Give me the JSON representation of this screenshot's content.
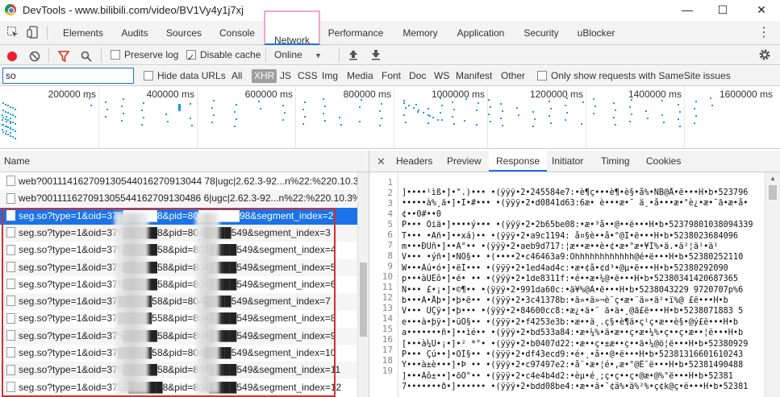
{
  "window": {
    "title": "DevTools - www.bilibili.com/video/BV1Vy4y1j7xj",
    "minimize": "—",
    "maximize": "☐",
    "close": "✕"
  },
  "main_tabs": [
    "Elements",
    "Audits",
    "Sources",
    "Console",
    "Network",
    "Performance",
    "Memory",
    "Application",
    "Security",
    "uBlocker"
  ],
  "active_main_tab": "Network",
  "network_toolbar": {
    "preserve_log": "Preserve log",
    "preserve_log_checked": false,
    "disable_cache": "Disable cache",
    "disable_cache_checked": true,
    "throttle": "Online"
  },
  "filter": {
    "value": "so",
    "hide_data_urls": "Hide data URLs",
    "types": [
      "All",
      "XHR",
      "JS",
      "CSS",
      "Img",
      "Media",
      "Font",
      "Doc",
      "WS",
      "Manifest",
      "Other"
    ],
    "active_type": "XHR",
    "samesite": "Only show requests with SameSite issues"
  },
  "timeline_ticks": [
    "200000 ms",
    "400000 ms",
    "600000 ms",
    "800000 ms",
    "1000000 ms",
    "1200000 ms",
    "1400000 ms",
    "1600000 ms"
  ],
  "list_header": "Name",
  "requests": [
    "web?001114162709130544016270913044 78|ugc|2.62.3-92...n%22:%220.10.3%2",
    "web?001111627091305544162709130486 6|ugc|2.62.3-92...n%22:%220.10.3%2",
    "seg.so?type=1&oid=375█████8&pid=80██████98&segment_index=2",
    "seg.so?type=1&oid=375█████8&pid=804████549&segment_index=3",
    "seg.so?type=1&oid=375█████58&pid=804████549&segment_index=4",
    "seg.so?type=1&oid=375█████58&pid=804████549&segment_index=5",
    "seg.so?type=1&oid=375█████58&pid=804████549&segment_index=6",
    "seg.so?type=1&oid=37█████58&pid=804████549&segment_index=7",
    "seg.so?type=1&oid=37█████558&pid=804████549&segment_index=8",
    "seg.so?type=1&oid=375█████58&pid=804████549&segment_index=9",
    "seg.so?type=1&oid=37█████58&pid=804████549&segment_index=10",
    "seg.so?type=1&oid=375█████58&pid=804████549&segment_index=11",
    "seg.so?type=1&oid=3752█████8&pid=804████549&segment_index=12"
  ],
  "selected_request_index": 2,
  "detail_tabs": [
    "Headers",
    "Preview",
    "Response",
    "Initiator",
    "Timing",
    "Cookies"
  ],
  "active_detail_tab": "Response",
  "line_numbers": [
    "1",
    "2",
    "3",
    "4",
    "5",
    "6",
    "7",
    "8",
    "9",
    "10",
    "11",
    "12",
    "13",
    "14",
    "15",
    "16",
    "17",
    "18",
    "19"
  ],
  "response_lines": [
    "]••••¹ìß•]•°.)•••  •(ÿÿÿ•2•245584e7:•è¶ç•••è¶•è§•å%•NB@Å•ë•••H•b•523796",
    "•••••à%¸ä•]•Ï•#•••  •(ÿÿÿ•2•d0841d63:6æ• è•••æ•¯ ä¸•å•••æ•°è¿•æ•¯ã•æ•å•",
    "¢••0#••0",
    "P••• Òiä•]••••ý••• •(ÿÿÿ•2•2b65be08:•æ•³å••@••ë•••H•b•52379801038094339",
    "T••• •Äñ•]••xá)•• •(ÿÿÿ•2•a9c1194:    å¤§è••å•°@I•ë•••H•b•5238023684096",
    "m•••ÐÛñ•]••Ä°•• •(ÿÿÿ•2•aeb9d717:¦æ••æ••è•¢•æ•°æ•¥I%•ä.•ä²¦ä¹•ä¹",
    "V••• •ýñ•]•ÑÖ§•• •(••••2•c46463a9:Ohhhhhhhhhhhh@é•ë•••H•b•52380252110",
    "W•••Àú•ó•]•ëÎ••• •(ÿÿÿ•2•1ed4ad4c:•æ•¢å•¢d³•@µ•ë•••H•b•52380292090",
    "p•••àÜÉô•]•é•  •• •(ÿÿÿ•2•1de8311f:•é••æ•¼@•ë•••H•b•52380341420687365",
    "N••• £•¡•]•©¶•• •(ÿÿÿ•2•991da60c:•ä¥%@À•ë•••H•b•5238043229 9720707p%6",
    "b•••À•Åþ•]•þ•ë•• •(ÿÿÿ•2•3c41378b:•ä»•ä»¬è¨ç•æ•¨ä»•ä²•ï%@ £ë•••H•b",
    "V••• ÚÇÿ•]•þ••• •(ÿÿÿ•2•84600cc8:•æ¿•ä•¨ ä•ä•¸@ã£ë•••H•b•5238071883 5",
    "e•••à•þÿ•]•üÖ§•• •(ÿÿÿ•2•f4253e3b:•æ••ä¸.ç§•è¶ä•ç¹ç•æ••è§•@ý£ë•••H•b",
    "a•••••••ñ•]••ìé•• •(ÿÿÿ•2•bd533a84:•æ•¼%•ä•æ••ç•æ•¼%•ç••ç•æ••¦ë•••H•b",
    "[•••à¼Ü•¡•]•²  *°• •(ÿÿÿ•2•b0407d22:•æ••ç•±æ••ç••ä•¼@ö¦ë•••H•b•52380929",
    "P••• Çú••]•ÒÌ§•• •(ÿÿÿ•2•df43ecd9:•é•¸•å••@•ë•••H•b•52381316601610243",
    "Y•••à±è•••]•Þ  •• •(ÿÿÿ•2•c97497e2:•å¨•æ•¦é•,æ•°@È¯ë•••H•b•52381490488",
    "]•••Àô±••]•õÔ°•• •(ÿÿÿ•2•c4e4b4d2:•èµ•é¸;ç•ç••ç•@æ•@%°ë•••H•b•52381",
    "7•••••••ð•]•••••• •(ÿÿÿ•2•bdd08be4:•æ••ä•¯¢ä%•ä%²%•ç¢k@ç•ë•••H•b•52381"
  ]
}
